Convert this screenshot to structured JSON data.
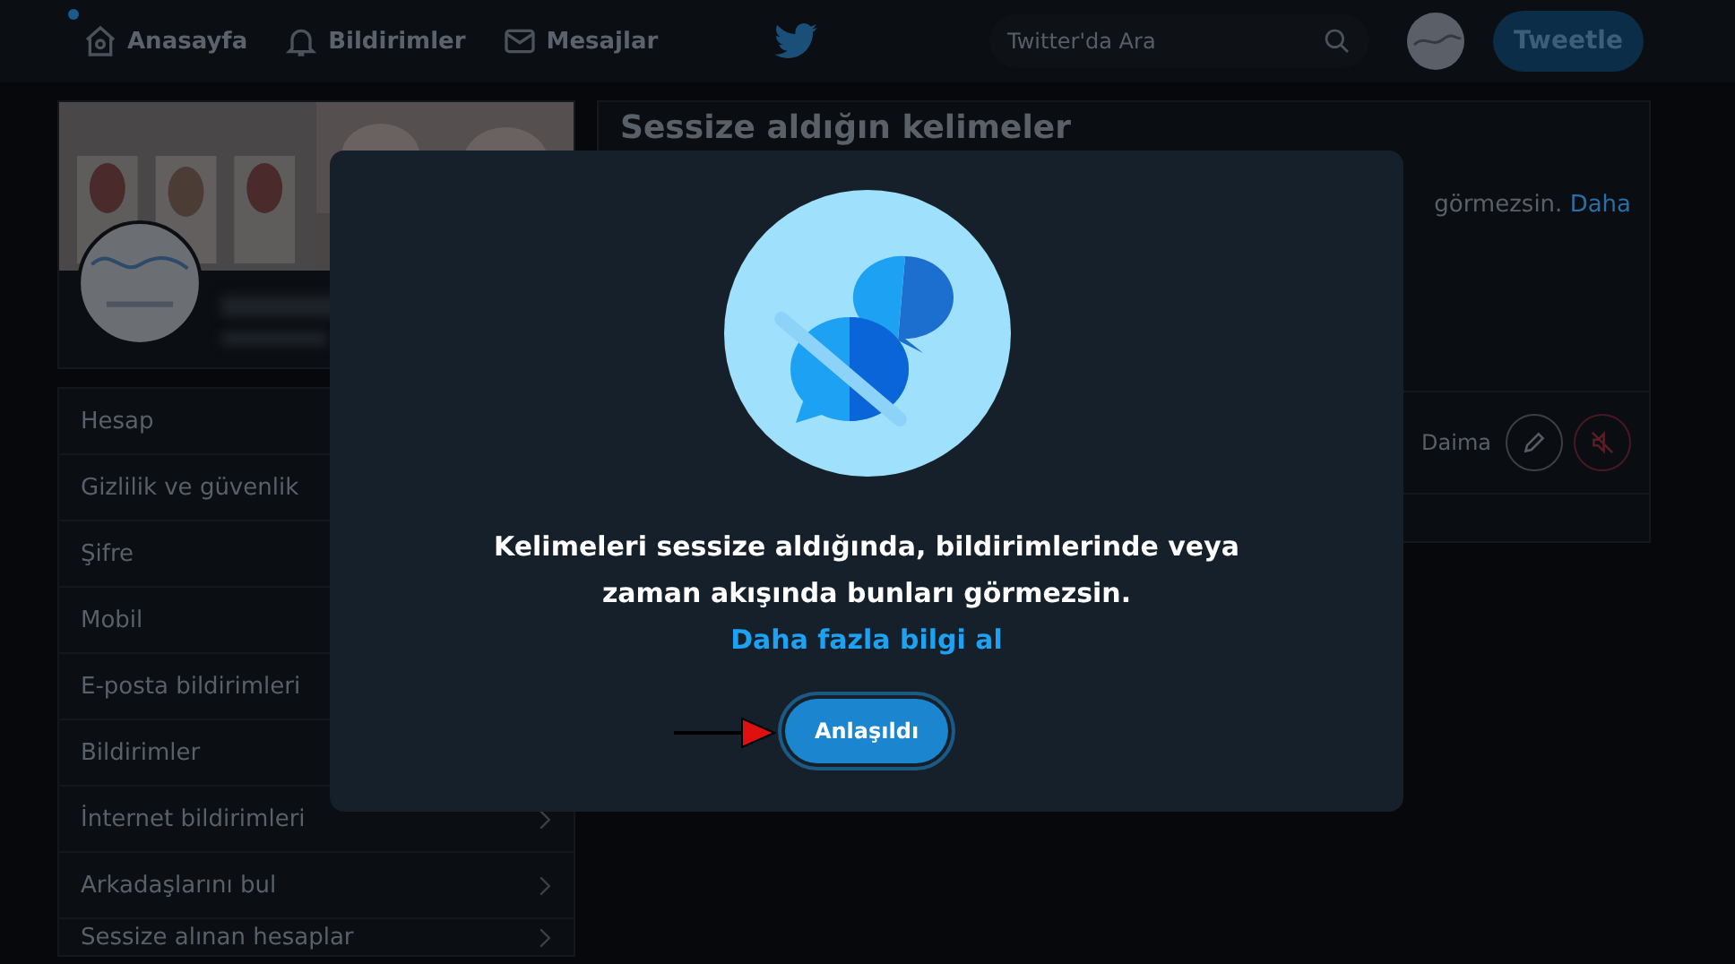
{
  "nav": {
    "items": [
      {
        "label": "Anasayfa",
        "badge": true
      },
      {
        "label": "Bildirimler",
        "badge": false
      },
      {
        "label": "Mesajlar",
        "badge": false
      }
    ],
    "search": {
      "placeholder": "Twitter'da Ara"
    },
    "tweet_button": "Tweetle"
  },
  "settings_menu": [
    {
      "label": "Hesap",
      "chevron": false
    },
    {
      "label": "Gizlilik ve güvenlik",
      "chevron": false
    },
    {
      "label": "Şifre",
      "chevron": false
    },
    {
      "label": "Mobil",
      "chevron": false
    },
    {
      "label": "E-posta bildirimleri",
      "chevron": false
    },
    {
      "label": "Bildirimler",
      "chevron": false
    },
    {
      "label": "İnternet bildirimleri",
      "chevron": true
    },
    {
      "label": "Arkadaşlarını bul",
      "chevron": true
    },
    {
      "label": "Sessize alınan hesaplar",
      "chevron": true
    }
  ],
  "main": {
    "title": "Sessize aldığın kelimeler",
    "description": "görmezsin.",
    "link": "Daha",
    "duration": "Daima"
  },
  "modal": {
    "message": "Kelimeleri sessize aldığında, bildirimlerinde veya zaman akışında bunları görmezsin.",
    "link": "Daha fazla bilgi al",
    "button": "Anlaşıldı"
  }
}
